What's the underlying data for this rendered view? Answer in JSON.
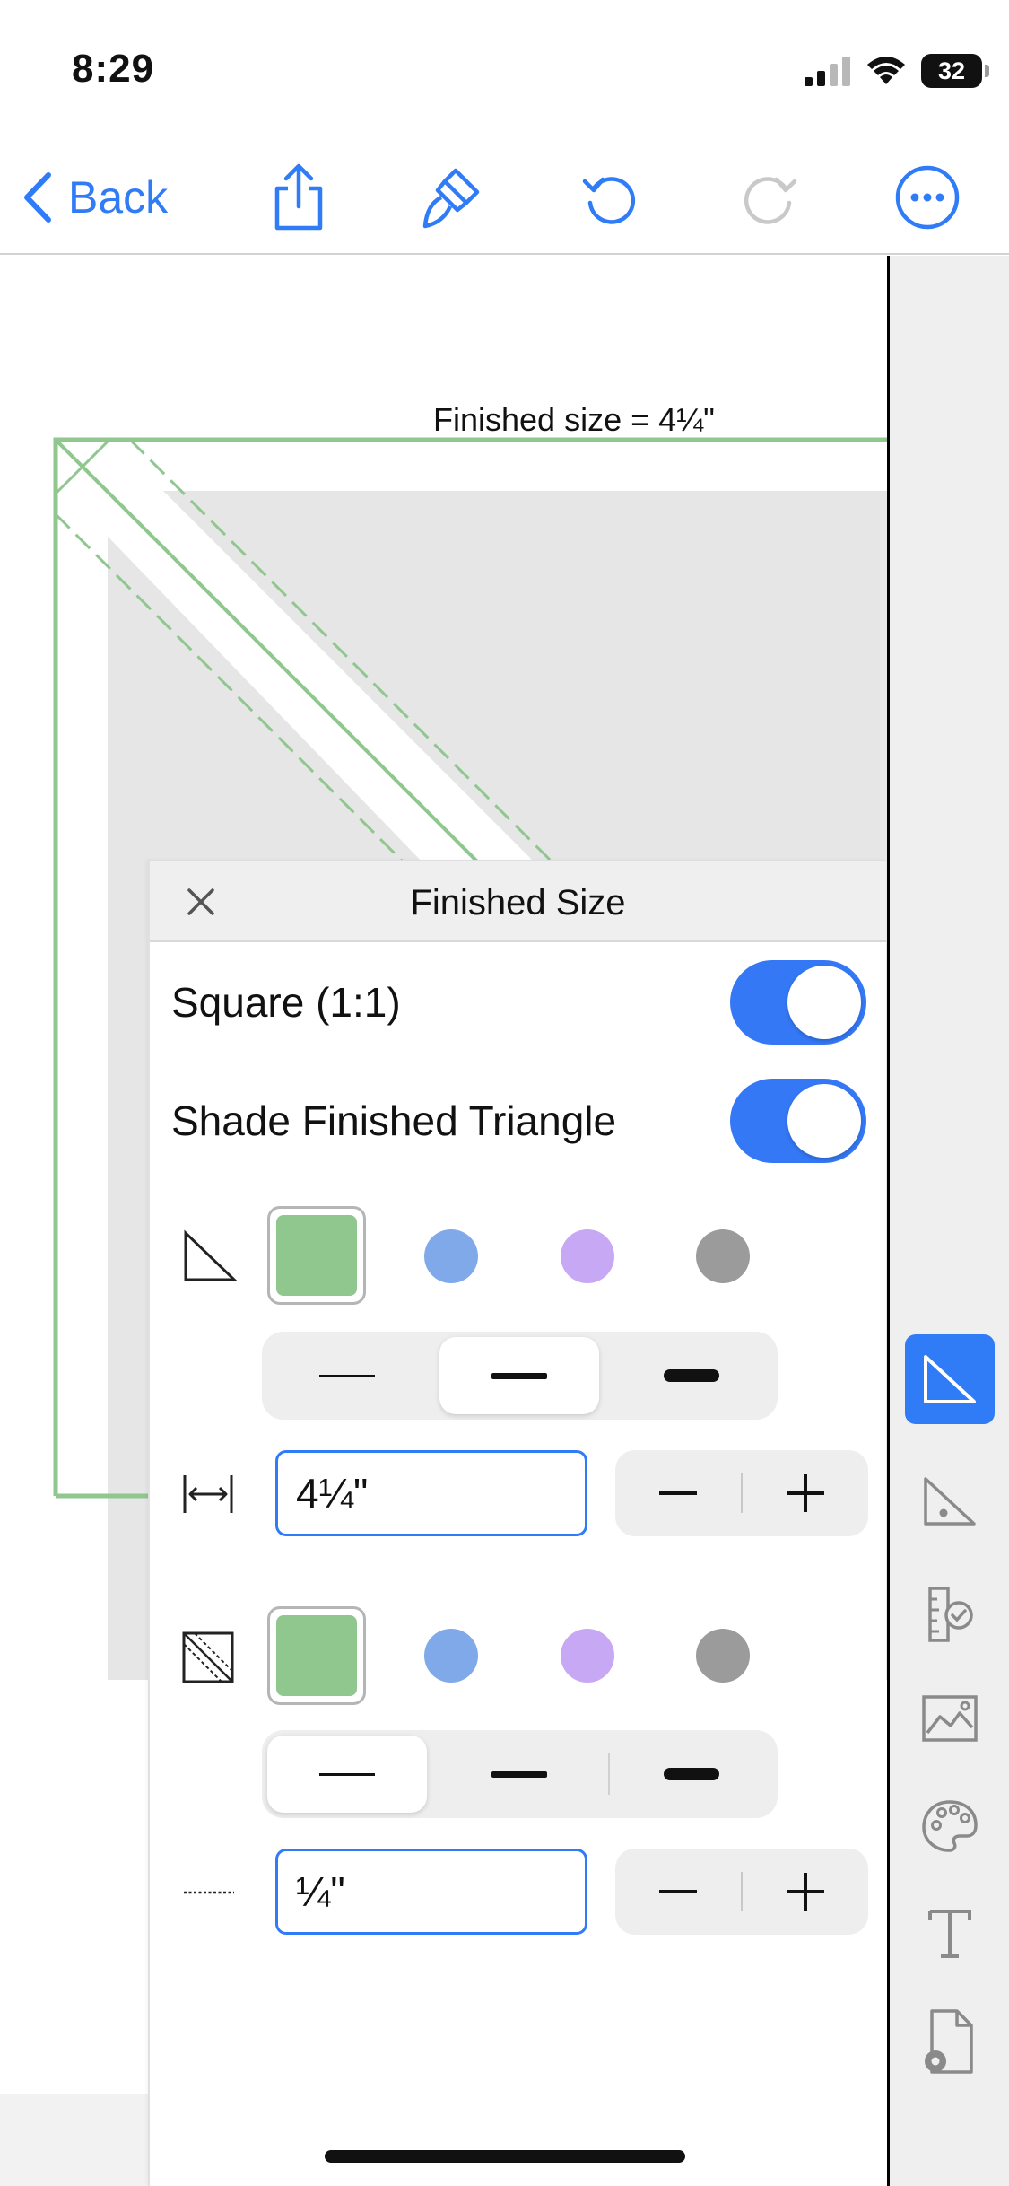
{
  "status_bar": {
    "time": "8:29",
    "battery": "32"
  },
  "toolbar": {
    "back_label": "Back"
  },
  "canvas": {
    "finished_size_label": "Finished size = 4¼\""
  },
  "panel": {
    "title": "Finished Size",
    "square_label": "Square (1:1)",
    "square_on": true,
    "shade_label": "Shade Finished Triangle",
    "shade_on": true,
    "triangle_colors": [
      "#8fc78f",
      "#80a9ea",
      "#c6a8f4",
      "#9b9b9b"
    ],
    "size_value": "4¼\"",
    "seam_value": "¼\"",
    "line_weight_selected_1": 1,
    "line_weight_selected_2": 0
  },
  "icons": {
    "back": "chevron-left-icon",
    "share": "share-icon",
    "brush": "paintbrush-icon",
    "undo": "undo-icon",
    "redo": "redo-icon",
    "more": "more-icon"
  },
  "colors": {
    "accent": "#2f7cf6",
    "green_line": "#8fc78f",
    "shade": "#e6e6e6"
  }
}
